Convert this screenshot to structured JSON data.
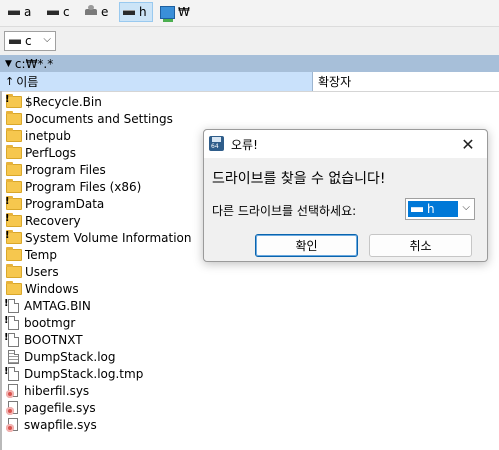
{
  "drive_toolbar": {
    "drives": [
      {
        "letter": "a",
        "icon": "hard-disk-icon"
      },
      {
        "letter": "c",
        "icon": "hard-disk-icon"
      },
      {
        "letter": "e",
        "icon": "optical-drive-icon"
      },
      {
        "letter": "h",
        "icon": "hard-disk-icon",
        "active": true
      },
      {
        "letter": "₩",
        "icon": "network-drive-icon"
      }
    ]
  },
  "drive_select": {
    "value": "c",
    "arrow": "⌵"
  },
  "path_bar": {
    "path": "c:₩*.*"
  },
  "columns": {
    "name": "이름",
    "ext": "확장자",
    "sort_arrow": "↑"
  },
  "files": [
    {
      "name": "$Recycle.Bin",
      "type": "folder-hidden"
    },
    {
      "name": "Documents and Settings",
      "type": "folder"
    },
    {
      "name": "inetpub",
      "type": "folder"
    },
    {
      "name": "PerfLogs",
      "type": "folder"
    },
    {
      "name": "Program Files",
      "type": "folder"
    },
    {
      "name": "Program Files (x86)",
      "type": "folder"
    },
    {
      "name": "ProgramData",
      "type": "folder-hidden"
    },
    {
      "name": "Recovery",
      "type": "folder-hidden"
    },
    {
      "name": "System Volume Information",
      "type": "folder-hidden"
    },
    {
      "name": "Temp",
      "type": "folder"
    },
    {
      "name": "Users",
      "type": "folder"
    },
    {
      "name": "Windows",
      "type": "folder"
    },
    {
      "name": "AMTAG.BIN",
      "type": "file-hidden"
    },
    {
      "name": "bootmgr",
      "type": "file-hidden"
    },
    {
      "name": "BOOTNXT",
      "type": "file-hidden"
    },
    {
      "name": "DumpStack.log",
      "type": "log"
    },
    {
      "name": "DumpStack.log.tmp",
      "type": "file-hidden"
    },
    {
      "name": "hiberfil.sys",
      "type": "sys"
    },
    {
      "name": "pagefile.sys",
      "type": "sys"
    },
    {
      "name": "swapfile.sys",
      "type": "sys"
    }
  ],
  "dialog": {
    "title": "오류!",
    "message": "드라이브를 찾을 수 없습니다!",
    "select_label": "다른 드라이브를 선택하세요:",
    "selected_drive": "h",
    "ok_label": "확인",
    "cancel_label": "취소",
    "close_glyph": "✕",
    "arrow": "⌵"
  },
  "colors": {
    "path_bar_bg": "#a7bfd9",
    "name_header_bg": "#c9e1fb",
    "selection_blue": "#0078d7",
    "folder_yellow": "#f6c74e"
  }
}
